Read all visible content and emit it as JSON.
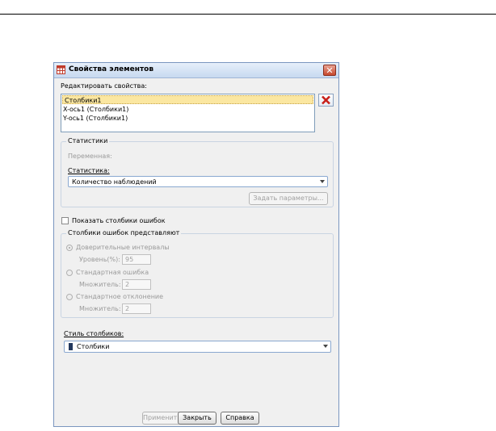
{
  "dialog": {
    "title": "Свойства элементов",
    "edit_label": "Редактировать свойства:",
    "elements": [
      "Столбики1",
      "X-ось1 (Столбики1)",
      "Y-ось1 (Столбики1)"
    ],
    "statistics": {
      "group_title": "Статистики",
      "variable_label": "Переменная:",
      "statistic_label": "Статистика:",
      "statistic_value": "Количество наблюдений",
      "set_params_label": "Задать параметры..."
    },
    "show_error_bars_label": "Показать столбики ошибок",
    "error_bars": {
      "group_title": "Столбики ошибок представляют",
      "ci_label": "Доверительные интервалы",
      "level_label": "Уровень(%):",
      "level_value": "95",
      "se_label": "Стандартная ошибка",
      "se_mult_label": "Множитель:",
      "se_mult_value": "2",
      "sd_label": "Стандартное отклонение",
      "sd_mult_label": "Множитель:",
      "sd_mult_value": "2"
    },
    "bar_style_label": "Стиль столбиков:",
    "bar_style_value": "Столбики",
    "buttons": {
      "apply": "Применить",
      "close": "Закрыть",
      "help": "Справка"
    }
  }
}
